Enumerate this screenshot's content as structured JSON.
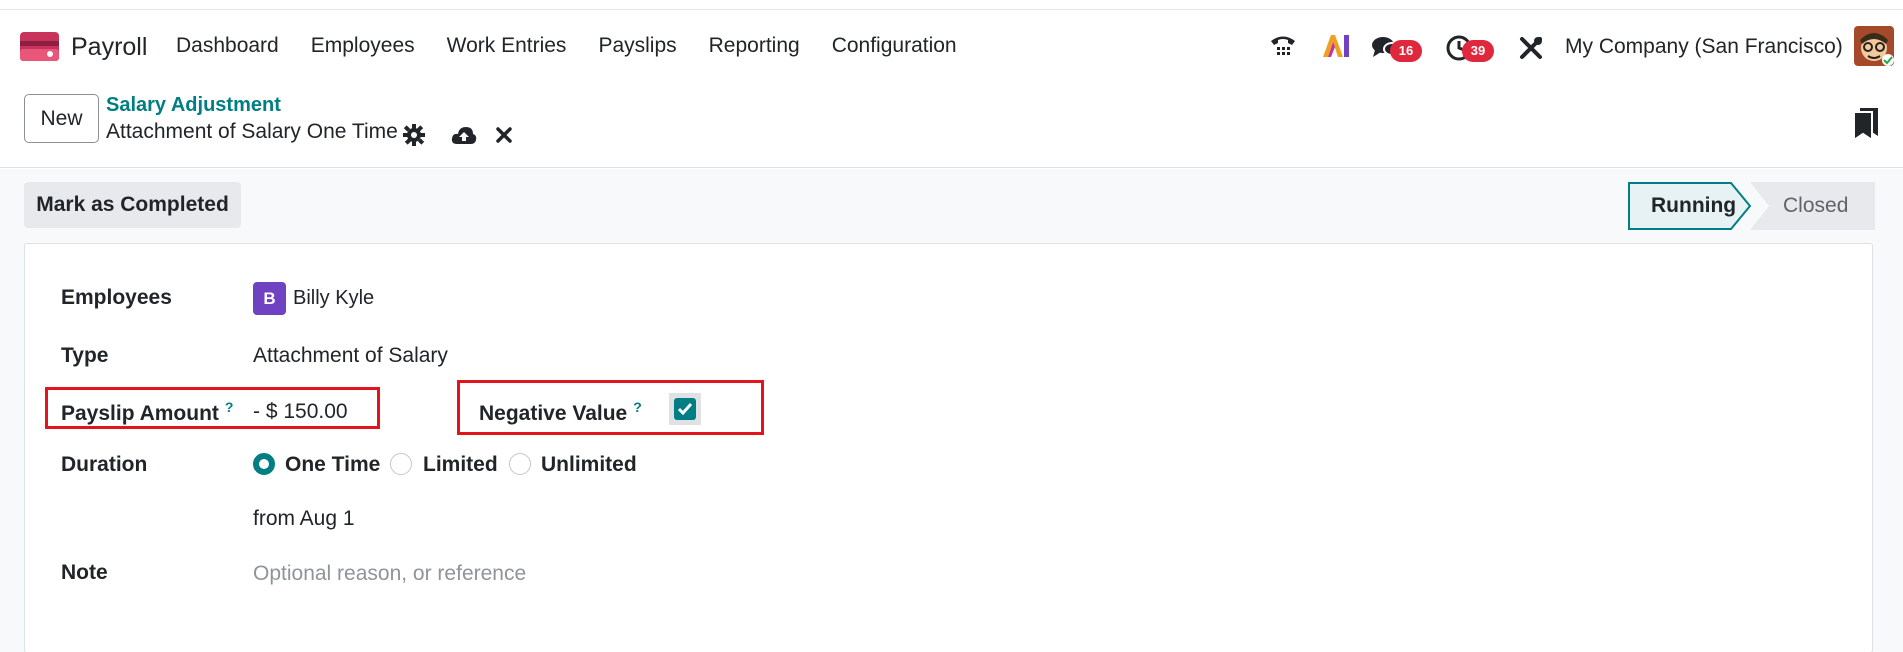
{
  "navbar": {
    "app_name": "Payroll",
    "menu": [
      "Dashboard",
      "Employees",
      "Work Entries",
      "Payslips",
      "Reporting",
      "Configuration"
    ],
    "messages_badge": "16",
    "activities_badge": "39",
    "company": "My Company (San Francisco)",
    "icons": [
      "phone-icon",
      "ai-icon",
      "chat-icon",
      "clock-icon",
      "tools-icon"
    ]
  },
  "control_panel": {
    "new_label": "New",
    "breadcrumb": "Salary Adjustment",
    "record_title": "Attachment of Salary One Time"
  },
  "actions": {
    "mark_completed": "Mark as Completed"
  },
  "status": {
    "stages": [
      "Running",
      "Closed"
    ],
    "active": "Running"
  },
  "form": {
    "employees_label": "Employees",
    "employee_initial": "B",
    "employee_name": "Billy Kyle",
    "type_label": "Type",
    "type_value": "Attachment of Salary",
    "payslip_amount_label": "Payslip Amount",
    "payslip_amount_help": "?",
    "payslip_amount_value": "- $ 150.00",
    "negative_value_label": "Negative Value",
    "negative_value_help": "?",
    "negative_value_checked": true,
    "duration_label": "Duration",
    "duration_options": [
      "One Time",
      "Limited",
      "Unlimited"
    ],
    "duration_selected": "One Time",
    "from_text": "from Aug 1",
    "note_label": "Note",
    "note_placeholder": "Optional reason, or reference"
  },
  "colors": {
    "accent": "#017e84",
    "highlight": "#e3141b",
    "badge": "#e0283d",
    "employee_avatar": "#6f42c1"
  }
}
